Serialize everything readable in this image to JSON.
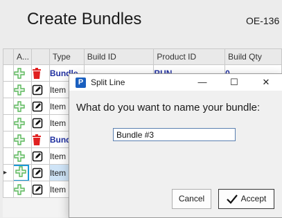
{
  "page": {
    "title": "Create Bundles",
    "order_id": "OE-136"
  },
  "grid": {
    "columns": [
      "A...",
      "",
      "Type",
      "Build ID",
      "Product ID",
      "Build Qty"
    ],
    "rows": [
      {
        "kind": "bundle",
        "type": "Bundle",
        "product": "RUN",
        "qty": "0"
      },
      {
        "kind": "item",
        "type": "Item"
      },
      {
        "kind": "item",
        "type": "Item"
      },
      {
        "kind": "item",
        "type": "Item"
      },
      {
        "kind": "bundle",
        "type": "Bund"
      },
      {
        "kind": "item",
        "type": "Item"
      },
      {
        "kind": "item",
        "type": "Item",
        "selected": true
      },
      {
        "kind": "item",
        "type": "Item"
      }
    ],
    "row_pointer": "▸"
  },
  "dialog": {
    "title": "Split Line",
    "app_icon_letter": "P",
    "minimize_glyph": "—",
    "maximize_glyph": "☐",
    "close_glyph": "✕",
    "prompt": "What do you want to name your bundle:",
    "name_value": "Bundle #3",
    "cancel_label": "Cancel",
    "accept_label": "Accept"
  },
  "colors": {
    "add_icon": "#5cb85c",
    "delete_icon": "#e02020",
    "bundle_text": "#1f2fa0",
    "focus": "#1a9ad6"
  },
  "icons": {
    "add": "plus-icon",
    "delete": "trash-icon",
    "edit": "edit-icon"
  }
}
